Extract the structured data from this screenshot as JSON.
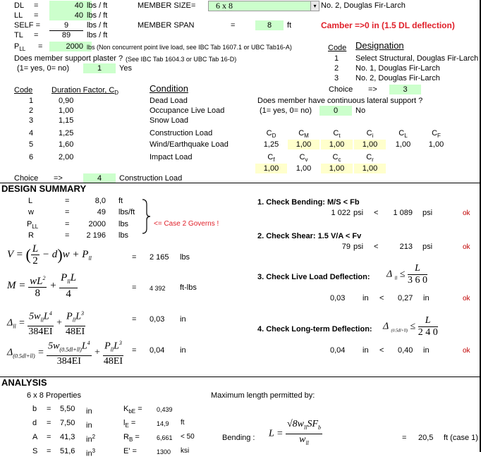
{
  "loads": {
    "dl": {
      "label": "DL",
      "eq": "=",
      "value": "40",
      "unit": "lbs / ft"
    },
    "ll": {
      "label": "LL",
      "eq": "=",
      "value": "40",
      "unit": "lbs / ft"
    },
    "self": {
      "label": "SELF =",
      "value": "9",
      "unit": "lbs / ft"
    },
    "tl": {
      "label": "TL",
      "eq": "=",
      "value": "89",
      "unit": "lbs / ft"
    },
    "pll": {
      "label": "P",
      "label_sub": "LL",
      "eq": "=",
      "value": "2000",
      "unit": "lbs (Non concurrent point live load, see IBC Tab 1607.1 or UBC Tab16-A)"
    }
  },
  "member": {
    "size_label": "MEMBER SIZE",
    "size_eq": "=",
    "size_value": "6 x 8",
    "grade_text": "No. 2, Douglas Fir-Larch",
    "span_label": "MEMBER SPAN",
    "span_eq": "=",
    "span_value": "8",
    "span_unit": "ft",
    "camber": "Camber =>0 in  (1.5 DL deflection)"
  },
  "plaster": {
    "question": "Does member support plaster ?",
    "ref": "(See IBC Tab 1604.3 or UBC Tab 16-D)",
    "hint": "(1= yes, 0= no)",
    "value": "1",
    "answer": "Yes"
  },
  "designation": {
    "code_header": "Code",
    "header": "Designation",
    "rows": [
      {
        "code": "1",
        "name": "Select Structural, Douglas Fir-Larch"
      },
      {
        "code": "2",
        "name": "No. 1, Douglas Fir-Larch"
      },
      {
        "code": "3",
        "name": "No. 2, Douglas Fir-Larch"
      }
    ],
    "choice_label": "Choice",
    "choice_arrow": "=>",
    "choice_value": "3"
  },
  "duration": {
    "code_header": "Code",
    "factor_header": "Duration Factor, C",
    "factor_header_sub": "D",
    "condition_header": "Condition",
    "rows": [
      {
        "code": "1",
        "factor": "0,90",
        "condition": "Dead Load"
      },
      {
        "code": "2",
        "factor": "1,00",
        "condition": "Occupance Live Load"
      },
      {
        "code": "3",
        "factor": "1,15",
        "condition": "Snow Load"
      },
      {
        "code": "4",
        "factor": "1,25",
        "condition": "Construction Load"
      },
      {
        "code": "5",
        "factor": "1,60",
        "condition": "Wind/Earthquake Load"
      },
      {
        "code": "6",
        "factor": "2,00",
        "condition": "Impact Load"
      }
    ],
    "choice_label": "Choice",
    "choice_arrow": "=>",
    "choice_value": "4",
    "choice_text": "Construction Load"
  },
  "lateral": {
    "question": "Does member have continuous lateral support ?",
    "hint": "(1= yes, 0= no)",
    "value": "0",
    "answer": "No"
  },
  "factors": {
    "row1": [
      {
        "sym": "C",
        "sub": "D",
        "value": "1,25",
        "hl": false
      },
      {
        "sym": "C",
        "sub": "M",
        "value": "1,00",
        "hl": true
      },
      {
        "sym": "C",
        "sub": "t",
        "value": "1,00",
        "hl": true
      },
      {
        "sym": "C",
        "sub": "i",
        "value": "1,00",
        "hl": true
      },
      {
        "sym": "C",
        "sub": "L",
        "value": "1,00",
        "hl": false
      },
      {
        "sym": "C",
        "sub": "F",
        "value": "1,00",
        "hl": false
      }
    ],
    "row2": [
      {
        "sym": "C",
        "sub": "f",
        "value": "1,00",
        "hl": true
      },
      {
        "sym": "C",
        "sub": "v",
        "value": "1,00",
        "hl": false
      },
      {
        "sym": "C",
        "sub": "c",
        "value": "1,00",
        "hl": true
      },
      {
        "sym": "C",
        "sub": "r",
        "value": "1,00",
        "hl": true
      }
    ]
  },
  "summary": {
    "title": "DESIGN SUMMARY",
    "rows": [
      {
        "label": "L",
        "eq": "=",
        "value": "8,0",
        "unit": "ft"
      },
      {
        "label": "w",
        "eq": "=",
        "value": "49",
        "unit": "lbs/ft"
      },
      {
        "label": "P",
        "label_sub": "LL",
        "eq": "=",
        "value": "2000",
        "unit": "lbs"
      },
      {
        "label": "R",
        "eq": "=",
        "value": "2 196",
        "unit": "lbs"
      }
    ],
    "governs": "<= Case 2 Governs !",
    "formulas": [
      {
        "eq": "=",
        "value": "2 165",
        "unit": "lbs"
      },
      {
        "eq": "=",
        "value": "4 392",
        "unit": "ft-lbs"
      },
      {
        "eq": "=",
        "value": "0,03",
        "unit": "in"
      },
      {
        "eq": "=",
        "value": "0,04",
        "unit": "in"
      }
    ]
  },
  "checks": [
    {
      "title": "1. Check Bending:  M/S < Fb",
      "actual": "1 022",
      "actual_unit": "psi",
      "op": "<",
      "allow": "1 089",
      "allow_unit": "psi",
      "status": "ok"
    },
    {
      "title": "2. Check Shear:  1.5 V/A < Fv",
      "actual": "79",
      "actual_unit": "psi",
      "op": "<",
      "allow": "213",
      "allow_unit": "psi",
      "status": "ok"
    },
    {
      "title": "3. Check Live Load Deflection:",
      "limit_den": "3 6 0",
      "actual": "0,03",
      "actual_unit": "in",
      "op": "<",
      "allow": "0,27",
      "allow_unit": "in",
      "status": "ok"
    },
    {
      "title": "4. Check Long-term Deflection:",
      "limit_den": "2 4 0",
      "actual": "0,04",
      "actual_unit": "in",
      "op": "<",
      "allow": "0,40",
      "allow_unit": "in",
      "status": "ok"
    }
  ],
  "analysis": {
    "title": "ANALYSIS",
    "props_title": "6 x 8 Properties",
    "props": [
      {
        "label": "b",
        "eq": "=",
        "value": "5,50",
        "unit": "in"
      },
      {
        "label": "d",
        "eq": "=",
        "value": "7,50",
        "unit": "in"
      },
      {
        "label": "A",
        "eq": "=",
        "value": "41,3",
        "unit": "in",
        "unit_sup": "2"
      },
      {
        "label": "S",
        "eq": "=",
        "value": "51,6",
        "unit": "in",
        "unit_sup": "3"
      }
    ],
    "params": [
      {
        "label": "K",
        "label_sub": "bE",
        "eq": " =",
        "value": "0,439",
        "unit": ""
      },
      {
        "label": "l",
        "label_sub": "E",
        "eq": " =",
        "value": "14,9",
        "unit": "ft"
      },
      {
        "label": "R",
        "label_sub": "B",
        "eq": " =",
        "value": "6,661",
        "unit": "< 50"
      },
      {
        "label": "E'",
        "label_sub": "",
        "eq": " =",
        "value": "1300",
        "unit": "ksi"
      }
    ],
    "max_length_title": "Maximum length permitted by:",
    "bending_label": "Bending :",
    "bending_eq": "=",
    "bending_value": "20,5",
    "bending_unit": "ft  (case 1)"
  }
}
